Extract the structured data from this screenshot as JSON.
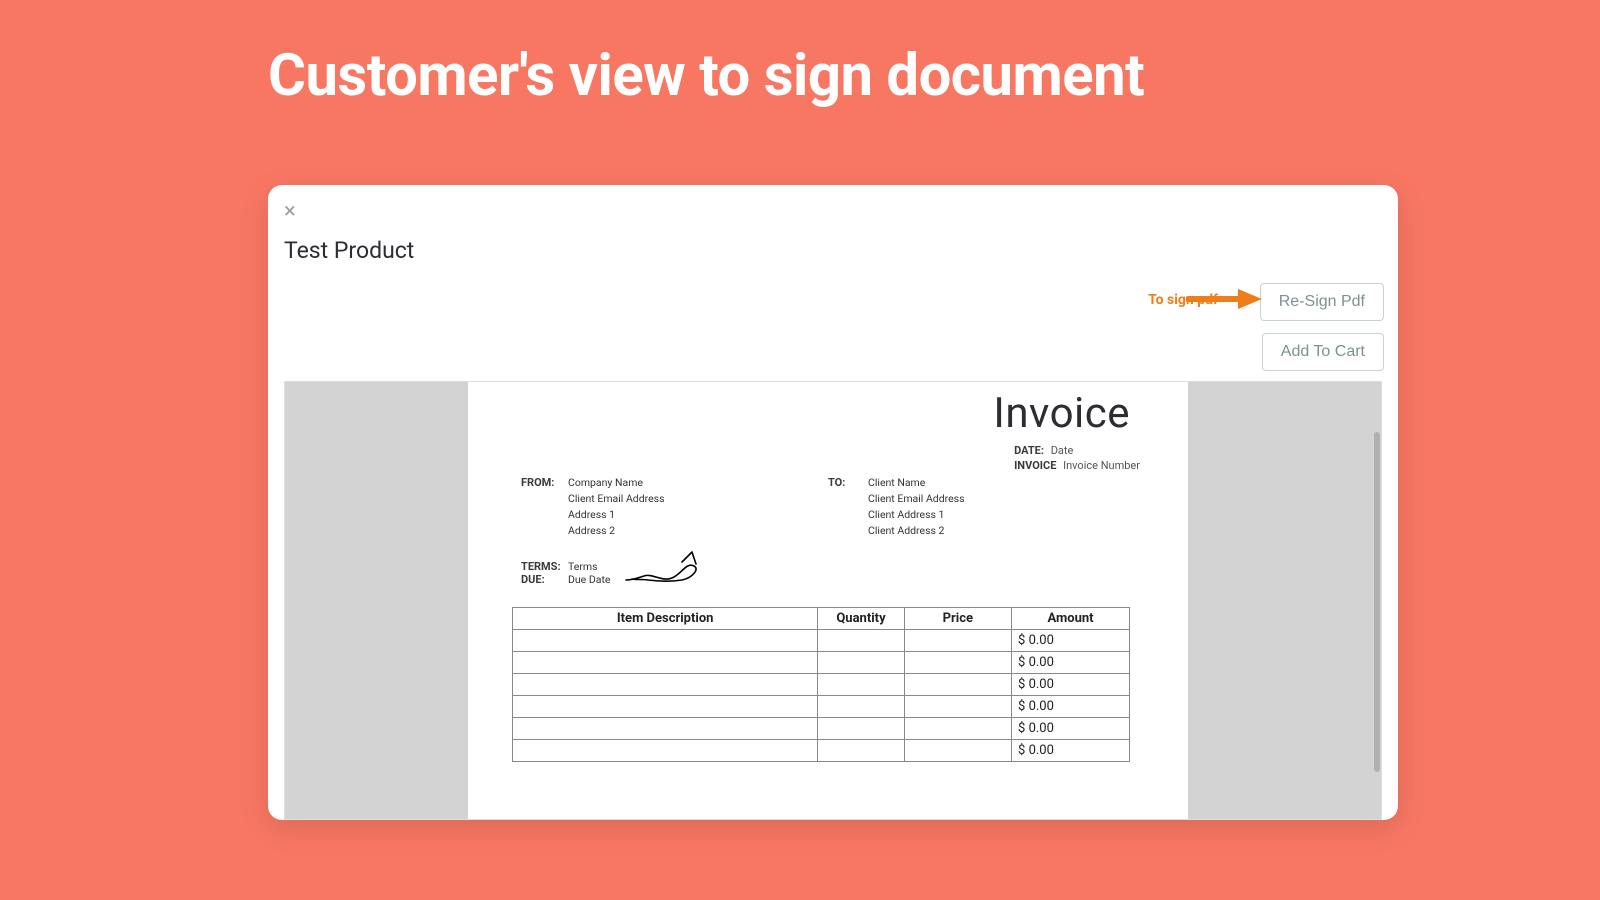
{
  "page": {
    "heading": "Customer's view to sign document"
  },
  "modal": {
    "close_glyph": "×",
    "product_title": "Test Product",
    "buttons": {
      "resign": "Re-Sign Pdf",
      "add_to_cart": "Add To Cart"
    },
    "annotations": {
      "to_sign": "To sign pdf",
      "signature": "Customer signature"
    }
  },
  "invoice": {
    "title": "Invoice",
    "meta": {
      "date_label": "DATE:",
      "date_value": "Date",
      "num_label": "INVOICE",
      "num_value": "Invoice Number"
    },
    "from": {
      "label": "FROM:",
      "lines": [
        "Company Name",
        "Client Email Address",
        "Address 1",
        "Address 2"
      ]
    },
    "to": {
      "label": "TO:",
      "lines": [
        "Client Name",
        "Client Email Address",
        "Client Address 1",
        "Client Address 2"
      ]
    },
    "terms": {
      "label": "TERMS:",
      "value": "Terms"
    },
    "due": {
      "label": "DUE:",
      "value": "Due Date"
    },
    "columns": {
      "desc": "Item Description",
      "qty": "Quantity",
      "price": "Price",
      "amount": "Amount"
    },
    "rows": [
      {
        "desc": "",
        "qty": "",
        "price": "",
        "amount": "$ 0.00"
      },
      {
        "desc": "",
        "qty": "",
        "price": "",
        "amount": "$ 0.00"
      },
      {
        "desc": "",
        "qty": "",
        "price": "",
        "amount": "$ 0.00"
      },
      {
        "desc": "",
        "qty": "",
        "price": "",
        "amount": "$ 0.00"
      },
      {
        "desc": "",
        "qty": "",
        "price": "",
        "amount": "$ 0.00"
      },
      {
        "desc": "",
        "qty": "",
        "price": "",
        "amount": "$ 0.00"
      }
    ]
  },
  "colors": {
    "accent_orange": "#ef7d1a",
    "background": "#f87763"
  }
}
